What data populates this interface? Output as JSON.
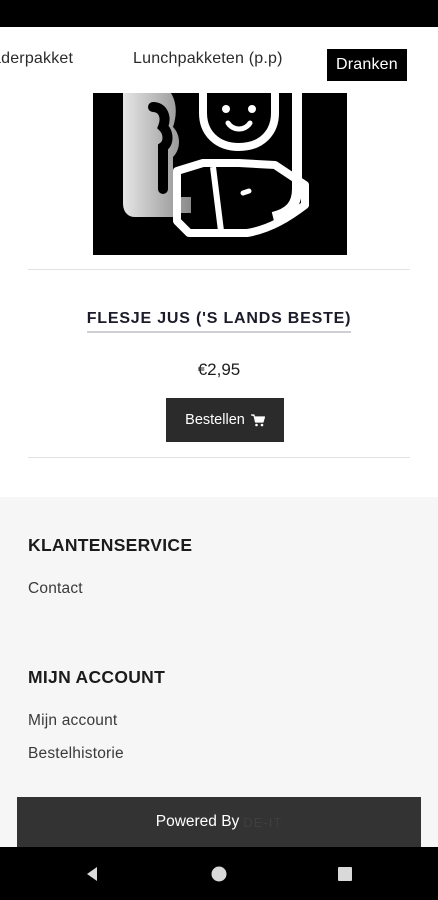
{
  "categories": {
    "tabs": [
      {
        "label": "aderpakket"
      },
      {
        "label": "Lunchpakketen (p.p)"
      },
      {
        "label": "Dranken"
      }
    ],
    "active": "Dranken"
  },
  "product": {
    "title": "FLESJE JUS ('S LANDS BESTE)",
    "price": "€2,95",
    "order_label": "Bestellen",
    "order_icon": "shopping-cart-icon"
  },
  "footer": {
    "customer_service": {
      "heading": "KLANTENSERVICE",
      "links": [
        "Contact"
      ]
    },
    "account": {
      "heading": "MIJN ACCOUNT",
      "links": [
        "Mijn account",
        "Bestelhistorie"
      ]
    },
    "powered_by": "Powered By",
    "brand": "DE-IT"
  },
  "system_nav": {
    "icons": [
      "back-icon",
      "home-icon",
      "recents-icon"
    ]
  },
  "colors": {
    "status_bar": "#000000",
    "active_tab_bg": "#000000",
    "button_bg": "#2b2b2b",
    "footer_bg": "#f6f6f6",
    "powered_bar_bg": "#333333",
    "nav_bar": "#000000"
  }
}
